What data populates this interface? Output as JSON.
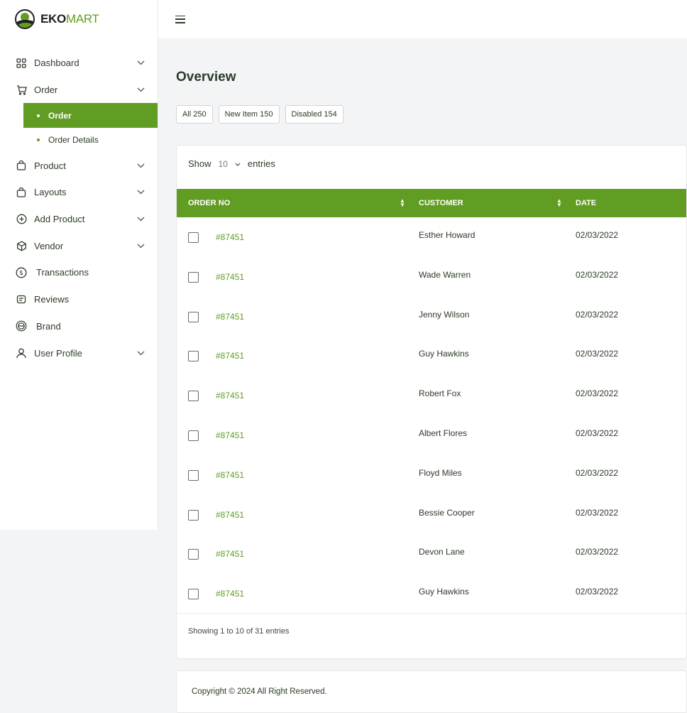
{
  "brand": {
    "bold": "EKO",
    "light": "MART",
    "accent_color": "#629d23"
  },
  "sidebar": {
    "items": [
      {
        "label": "Dashboard",
        "icon": "grid-icon",
        "has_chevron": true
      },
      {
        "label": "Order",
        "icon": "cart-icon",
        "has_chevron": true,
        "children": [
          {
            "label": "Order",
            "active": true
          },
          {
            "label": "Order Details",
            "active": false
          }
        ]
      },
      {
        "label": "Product",
        "icon": "bag-icon",
        "has_chevron": true
      },
      {
        "label": "Layouts",
        "icon": "bag-icon",
        "has_chevron": true
      },
      {
        "label": "Add Product",
        "icon": "plus-circle-icon",
        "has_chevron": true
      },
      {
        "label": "Vendor",
        "icon": "box-icon",
        "has_chevron": true
      },
      {
        "label": "Transactions",
        "icon": "dollar-circle-icon",
        "has_chevron": false
      },
      {
        "label": "Reviews",
        "icon": "review-icon",
        "has_chevron": false
      },
      {
        "label": "Brand",
        "icon": "brand-badge-icon",
        "has_chevron": false
      },
      {
        "label": "User Profile",
        "icon": "user-icon",
        "has_chevron": true
      }
    ]
  },
  "header": {
    "menu_icon": "hamburger-icon"
  },
  "main": {
    "title": "Overview",
    "filters": [
      "All 250",
      "New Item 150",
      "Disabled 154"
    ],
    "show": {
      "prefix": "Show",
      "value": "10",
      "suffix": "entries"
    },
    "table": {
      "columns": [
        "ORDER NO",
        "CUSTOMER",
        "DATE"
      ],
      "rows": [
        {
          "order": "#87451",
          "customer": "Esther Howard",
          "date": "02/03/2022"
        },
        {
          "order": "#87451",
          "customer": "Wade Warren",
          "date": "02/03/2022"
        },
        {
          "order": "#87451",
          "customer": "Jenny Wilson",
          "date": "02/03/2022"
        },
        {
          "order": "#87451",
          "customer": "Guy Hawkins",
          "date": "02/03/2022"
        },
        {
          "order": "#87451",
          "customer": "Robert Fox",
          "date": "02/03/2022"
        },
        {
          "order": "#87451",
          "customer": "Albert Flores",
          "date": "02/03/2022"
        },
        {
          "order": "#87451",
          "customer": "Floyd Miles",
          "date": "02/03/2022"
        },
        {
          "order": "#87451",
          "customer": "Bessie Cooper",
          "date": "02/03/2022"
        },
        {
          "order": "#87451",
          "customer": "Devon Lane",
          "date": "02/03/2022"
        },
        {
          "order": "#87451",
          "customer": "Guy Hawkins",
          "date": "02/03/2022"
        }
      ]
    },
    "showing_text": "Showing 1 to 10 of 31 entries"
  },
  "footer": {
    "copyright": "Copyright © 2024 All Right Reserved."
  }
}
